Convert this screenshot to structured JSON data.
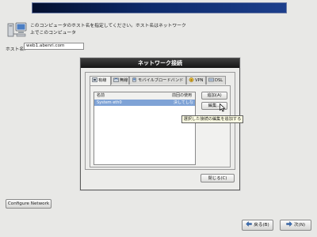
{
  "header": {
    "description": "このコンピュータのホスト名を指定してください。ホスト名はネットワーク上でこのコンピュータ",
    "hostname_label": "ホスト名:",
    "hostname_value": "web1.abenri.com"
  },
  "dialog": {
    "title": "ネットワーク接続",
    "tabs": [
      {
        "label": "有線",
        "icon": "wired-icon"
      },
      {
        "label": "無線",
        "icon": "wireless-icon"
      },
      {
        "label": "モバイルブロードバンド",
        "icon": "mobile-broadband-icon"
      },
      {
        "label": "VPN",
        "icon": "vpn-icon"
      },
      {
        "label": "DSL",
        "icon": "dsl-icon"
      }
    ],
    "active_tab": "有線",
    "columns": [
      "名前",
      "前回の使用"
    ],
    "rows": [
      {
        "name": "System eth0",
        "last_used": "決してしない"
      }
    ],
    "add_button": "追加(A)",
    "edit_button": "編集...",
    "tooltip": "選択した接続の編集を追加する",
    "close_button": "閉じる(C)"
  },
  "footer": {
    "configure_network": "Configure Network",
    "back_button": "戻る(B)",
    "next_button": "次(N)"
  },
  "colors": {
    "banner": "#0d2a6a",
    "selection": "#7fa3d6",
    "tooltip_bg": "#ffffe4"
  }
}
